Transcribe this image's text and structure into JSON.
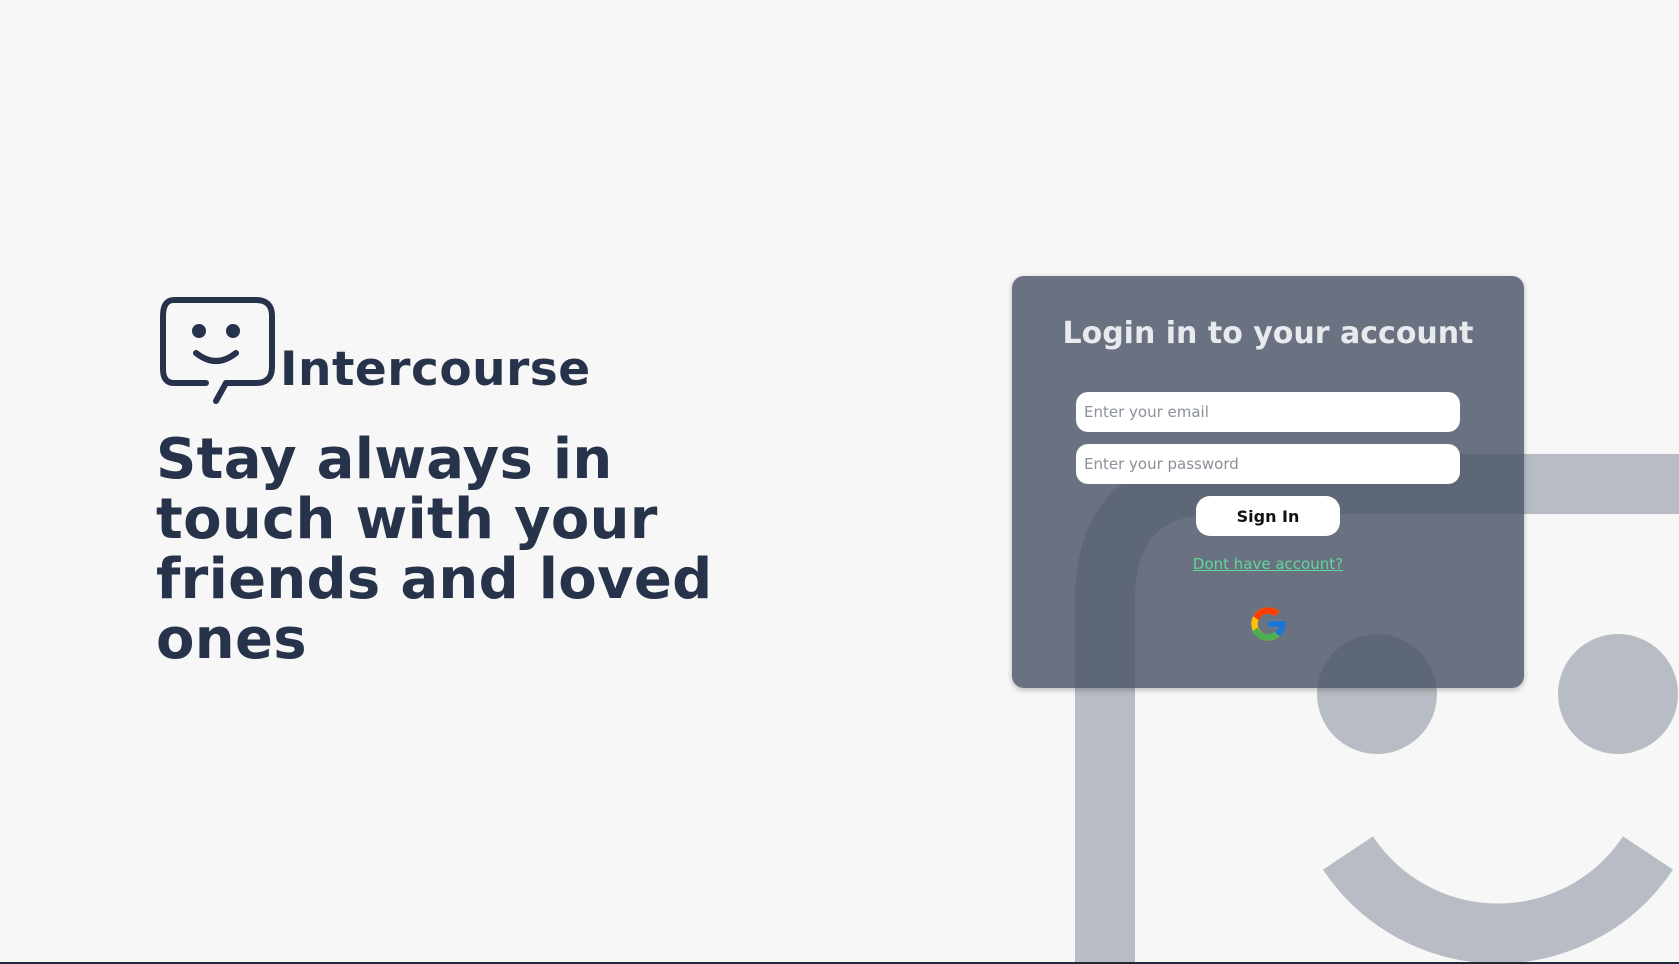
{
  "brand": {
    "name": "Intercourse",
    "logo_icon": "smiley-chat-bubble-icon"
  },
  "hero": {
    "tagline": "Stay always in touch with your friends and loved ones"
  },
  "login": {
    "title": "Login in to your account",
    "email_placeholder": "Enter your email",
    "email_value": "",
    "password_placeholder": "Enter your password",
    "password_value": "",
    "signin_label": "Sign In",
    "register_link": "Dont have account?",
    "google_icon": "google-icon"
  },
  "colors": {
    "background": "#f7f7f7",
    "brand_text": "#26334a",
    "card": "#4a5466",
    "link": "#5fd69a",
    "decor": "#b8bcc4"
  }
}
